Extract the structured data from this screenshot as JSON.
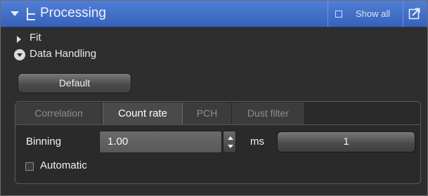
{
  "panel": {
    "title": "Processing",
    "show_all_label": "Show all"
  },
  "tree": {
    "fit_label": "Fit",
    "data_handling_label": "Data Handling"
  },
  "default_button_label": "Default",
  "tabs": [
    {
      "label": "Correlation",
      "active": false
    },
    {
      "label": "Count rate",
      "active": true
    },
    {
      "label": "PCH",
      "active": false
    },
    {
      "label": "Dust filter",
      "active": false
    }
  ],
  "binning": {
    "label": "Binning",
    "value": "1.00",
    "unit": "ms",
    "count_button_label": "1"
  },
  "automatic": {
    "label": "Automatic",
    "checked": false
  }
}
